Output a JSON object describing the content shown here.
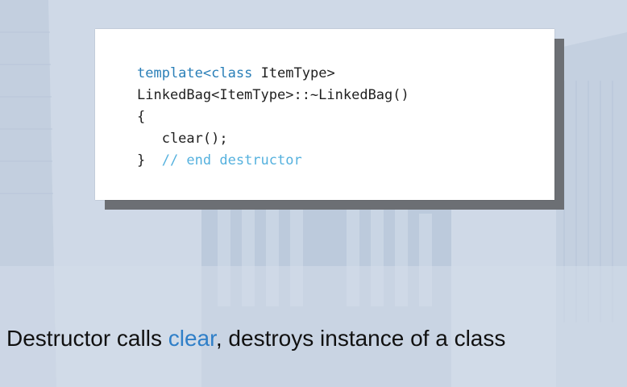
{
  "code": {
    "line1_keyword1": "template",
    "line1_bracket_open": "<",
    "line1_keyword2": "class",
    "line1_rest": " ItemType>",
    "line2": "LinkedBag<ItemType>::~LinkedBag()",
    "line3": "{",
    "line4": "   clear();",
    "line5_brace": "}",
    "line5_comment": "  // end destructor"
  },
  "caption": {
    "before": "Destructor calls ",
    "highlight": "clear",
    "after": ", destroys instance of a class"
  },
  "colors": {
    "keyword": "#2a7fb8",
    "comment": "#55b1de",
    "caption_highlight": "#2f7fc8"
  }
}
